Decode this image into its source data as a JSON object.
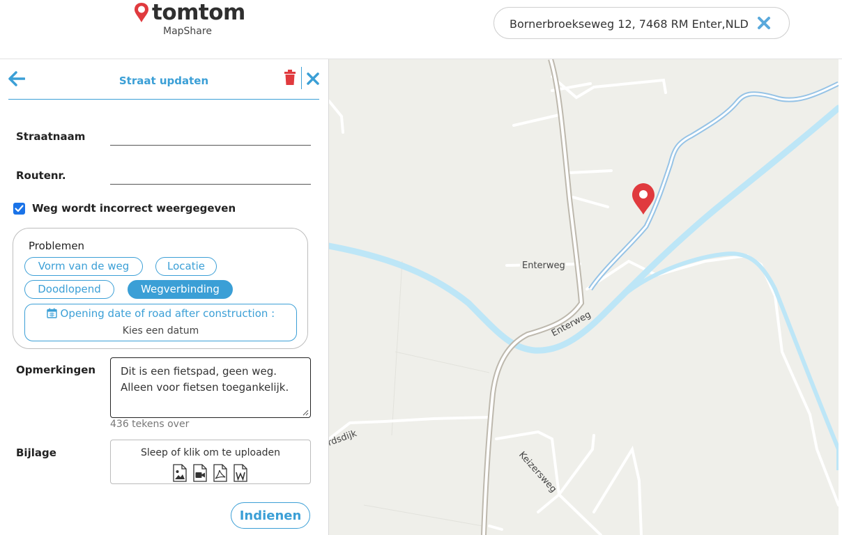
{
  "brand": {
    "name": "tomtom",
    "product": "MapShare"
  },
  "search": {
    "value": "Bornerbroekseweg 12, 7468 RM Enter,NLD"
  },
  "panel": {
    "title": "Straat updaten",
    "street_label": "Straatnaam",
    "route_label": "Routenr.",
    "checkbox_label": "Weg wordt incorrect weergegeven",
    "checkbox_checked": true,
    "problems": {
      "title": "Problemen",
      "options": [
        {
          "label": "Vorm van de weg",
          "selected": false
        },
        {
          "label": "Locatie",
          "selected": false
        },
        {
          "label": "Doodlopend",
          "selected": false
        },
        {
          "label": "Wegverbinding",
          "selected": true
        }
      ],
      "date_title": "Opening date of road after construction :",
      "date_placeholder": "Kies een datum"
    },
    "remarks_label": "Opmerkingen",
    "remarks_value": "Dit is een fietspad, geen weg. Alleen voor fietsen toegankelijk.",
    "remarks_counter": "436 tekens over",
    "attachment_label": "Bijlage",
    "upload_text": "Sleep of klik om te uploaden",
    "upload_icons": [
      "image-file-icon",
      "video-file-icon",
      "pdf-file-icon",
      "word-file-icon"
    ],
    "submit_label": "Indienen"
  },
  "map": {
    "labels": [
      "Enterweg",
      "Enterweg",
      "Keizersweg",
      "rdsdijk"
    ]
  },
  "colors": {
    "accent": "#3b9fd6",
    "danger": "#e03a3e",
    "river": "#bde6f7",
    "map_background": "#efefea"
  }
}
